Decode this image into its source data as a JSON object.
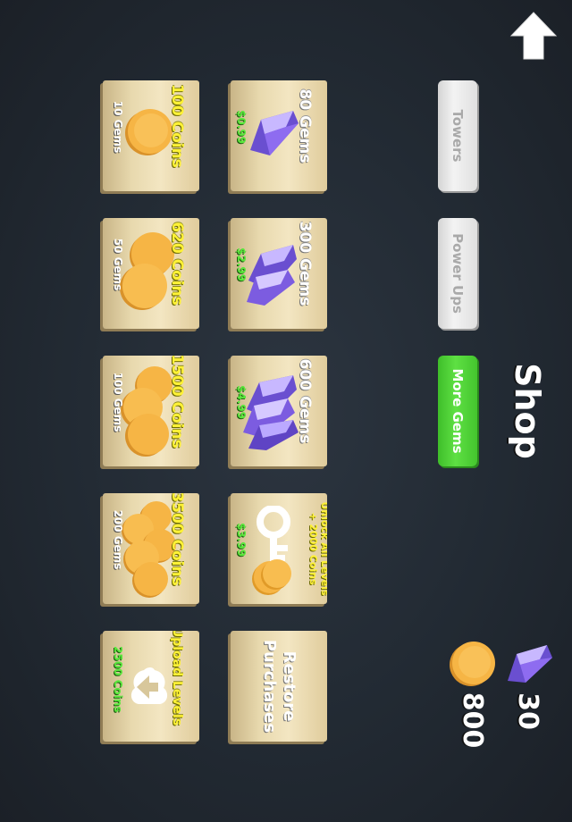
{
  "title": "Shop",
  "tabs": [
    {
      "label": "Towers",
      "active": false
    },
    {
      "label": "Power Ups",
      "active": false
    },
    {
      "label": "More Gems",
      "active": true
    }
  ],
  "gem_offers": [
    {
      "title": "80 Gems",
      "price": "$0.99"
    },
    {
      "title": "300 Gems",
      "price": "$2.99"
    },
    {
      "title": "600 Gems",
      "price": "$4.99"
    }
  ],
  "unlock_offer": {
    "title": "Unlock All Levels\n+ 2000 Coins",
    "price": "$3.99"
  },
  "restore": {
    "label": "Restore\nPurchases"
  },
  "coin_offers": [
    {
      "title": "100 Coins",
      "cost": "10 Gems"
    },
    {
      "title": "620 Coins",
      "cost": "50 Gems"
    },
    {
      "title": "1500 Coins",
      "cost": "100 Gems"
    },
    {
      "title": "3500 Coins",
      "cost": "200 Gems"
    }
  ],
  "upload_offer": {
    "title": "Upload Levels",
    "reward": "2500 Coins"
  },
  "balance": {
    "gems": "30",
    "coins": "800"
  },
  "icons": [
    "up-arrow-icon",
    "gem-icon",
    "coin-icon",
    "key-icon",
    "upload-cloud-icon"
  ],
  "colors": {
    "accent_green": "#4ccf33",
    "title_yellow": "#fff236",
    "price_green": "#59e83c",
    "card_tan": "#ecdcb0"
  }
}
